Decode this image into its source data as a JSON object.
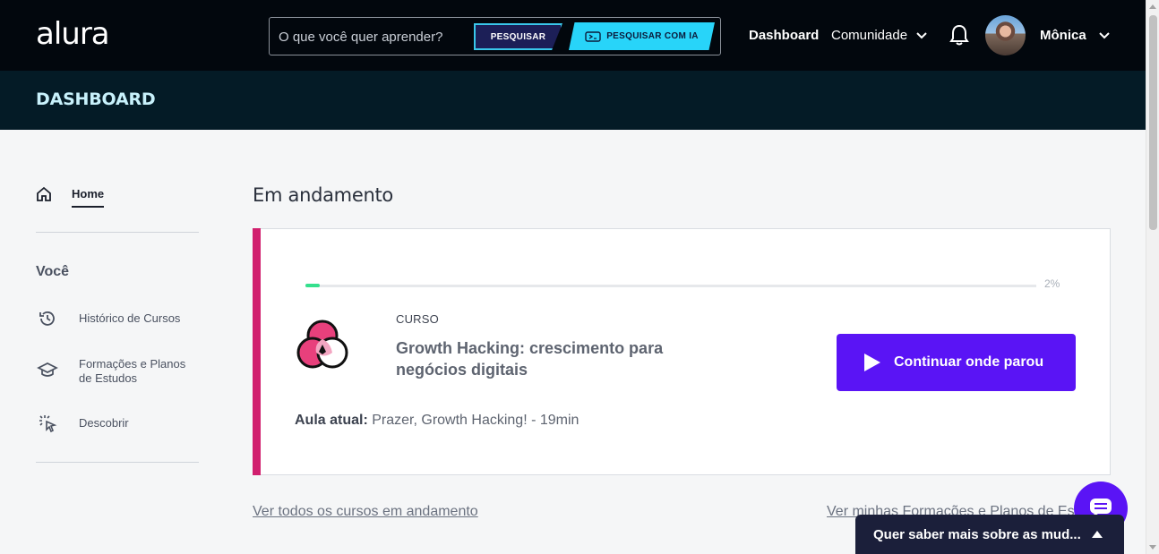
{
  "brand": {
    "logo_text": "alura"
  },
  "search": {
    "placeholder": "O que você quer aprender?",
    "search_label": "PESQUISAR",
    "ai_label": "PESQUISAR COM IA"
  },
  "nav": {
    "dashboard": "Dashboard",
    "community": "Comunidade"
  },
  "user": {
    "name": "Mônica"
  },
  "page": {
    "header": "DASHBOARD"
  },
  "sidebar": {
    "home": "Home",
    "section_title": "Você",
    "items": [
      {
        "label": "Histórico de Cursos",
        "icon": "history-icon"
      },
      {
        "label": "Formações e Planos de Estudos",
        "icon": "graduation-cap-icon"
      },
      {
        "label": "Descobrir",
        "icon": "discover-cursor-icon"
      }
    ]
  },
  "main": {
    "title": "Em andamento",
    "course": {
      "type": "CURSO",
      "title": "Growth Hacking: crescimento para negócios digitais",
      "progress": 0.02,
      "progress_label": "2%",
      "continue_label": "Continuar onde parou",
      "current_lesson_label": "Aula atual:",
      "current_lesson": "Prazer, Growth Hacking! - 19min"
    },
    "link_all_courses": "Ver todos os cursos em andamento",
    "link_formations": "Ver minhas Formações e Planos de Estudos"
  },
  "feedback": {
    "label": "Quer saber mais sobre as mud..."
  },
  "colors": {
    "accent": "#5a14f5",
    "course_accent": "#d11f6e",
    "progress": "#34e08d",
    "topbar": "#02070d",
    "subbar": "#041b26"
  }
}
